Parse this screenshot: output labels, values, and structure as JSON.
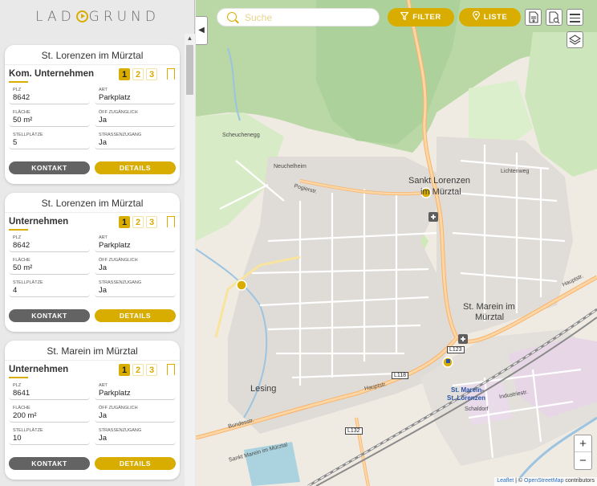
{
  "logo": {
    "text_left": "LAD",
    "text_right": "GRUND"
  },
  "search": {
    "placeholder": "Suche",
    "value": ""
  },
  "toolbar": {
    "filter_label": "FILTER",
    "list_label": "LISTE"
  },
  "colors": {
    "accent": "#d9ad00",
    "dark_button": "#636363"
  },
  "cards": [
    {
      "town": "St. Lorenzen im Mürztal",
      "type": "Kom. Unternehmen",
      "pages": [
        "1",
        "2",
        "3"
      ],
      "fields": [
        {
          "label": "PLZ",
          "value": "8642"
        },
        {
          "label": "ART",
          "value": "Parkplatz"
        },
        {
          "label": "FLÄCHE",
          "value": "50 m²"
        },
        {
          "label": "ÖFF ZUGÄNGLICH",
          "value": "Ja"
        },
        {
          "label": "STELLPLÄTZE",
          "value": "5"
        },
        {
          "label": "STRASSENZUGANG",
          "value": "Ja"
        }
      ],
      "contact_label": "KONTAKT",
      "details_label": "DETAILS"
    },
    {
      "town": "St. Lorenzen im Mürztal",
      "type": "Unternehmen",
      "pages": [
        "1",
        "2",
        "3"
      ],
      "fields": [
        {
          "label": "PLZ",
          "value": "8642"
        },
        {
          "label": "ART",
          "value": "Parkplatz"
        },
        {
          "label": "FLÄCHE",
          "value": "50 m²"
        },
        {
          "label": "ÖFF ZUGÄNGLICH",
          "value": "Ja"
        },
        {
          "label": "STELLPLÄTZE",
          "value": "4"
        },
        {
          "label": "STRASSENZUGANG",
          "value": "Ja"
        }
      ],
      "contact_label": "KONTAKT",
      "details_label": "DETAILS"
    },
    {
      "town": "St. Marein im Mürztal",
      "type": "Unternehmen",
      "pages": [
        "1",
        "2",
        "3"
      ],
      "fields": [
        {
          "label": "PLZ",
          "value": "8641"
        },
        {
          "label": "ART",
          "value": "Parkplatz"
        },
        {
          "label": "FLÄCHE",
          "value": "200 m²"
        },
        {
          "label": "ÖFF ZUGÄNGLICH",
          "value": "Ja"
        },
        {
          "label": "STELLPLÄTZE",
          "value": "10"
        },
        {
          "label": "STRASSENZUGANG",
          "value": "Ja"
        }
      ],
      "contact_label": "KONTAKT",
      "details_label": "DETAILS"
    }
  ],
  "map": {
    "labels": {
      "sankt_lorenzen": "Sankt Lorenzen",
      "im_muerztal_1": "im Mürztal",
      "st_marein": "St. Marein im",
      "muerztal_2": "Mürztal",
      "lesing": "Lesing",
      "marein_station_1": "St. Marein-",
      "marein_station_2": "St. Lorenzen",
      "schaldorf": "Schaldorf",
      "scheuchenegg": "Scheuchenegg",
      "neuchelheim": "Neuchelheim",
      "pogierstr": "Pogierstr.",
      "hauptstr_1": "Hauptstr.",
      "hauptstr_2": "Hauptstr.",
      "bundesstr": "Bundesstr.",
      "industriestr": "Industriestr.",
      "lichtenweg": "Lichtenweg",
      "sankt_marein_bottom": "Sankt Marein im Mürztal",
      "l123": "L123",
      "l118": "L118",
      "l132": "L132"
    },
    "attribution_leaflet": "Leaflet",
    "attribution_sep": " | © ",
    "attribution_osm": "OpenStreetMap",
    "attribution_tail": " contributors",
    "zoom_in": "+",
    "zoom_out": "−"
  }
}
